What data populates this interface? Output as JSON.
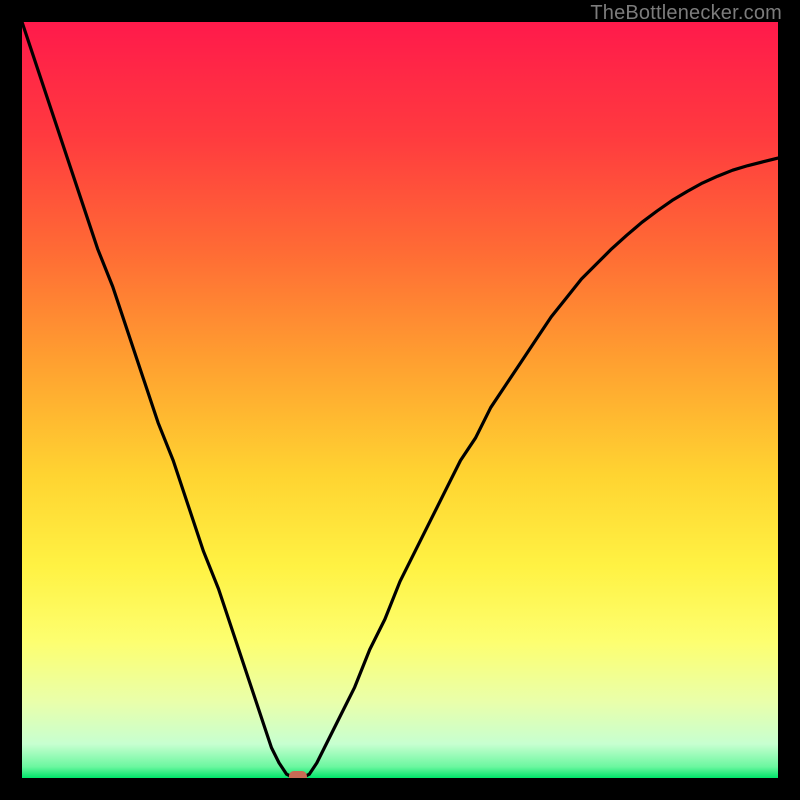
{
  "attribution": "TheBottlenecker.com",
  "chart_data": {
    "type": "line",
    "title": "",
    "xlabel": "",
    "ylabel": "",
    "xlim": [
      0,
      100
    ],
    "ylim": [
      0,
      100
    ],
    "curve": {
      "x": [
        0,
        2,
        4,
        6,
        8,
        10,
        12,
        14,
        16,
        18,
        20,
        22,
        24,
        26,
        28,
        30,
        32,
        33,
        34,
        35,
        36,
        37,
        38,
        39,
        40,
        42,
        44,
        46,
        48,
        50,
        52,
        54,
        56,
        58,
        60,
        62,
        64,
        66,
        68,
        70,
        72,
        74,
        76,
        78,
        80,
        82,
        84,
        86,
        88,
        90,
        92,
        94,
        96,
        98,
        100
      ],
      "y": [
        100,
        94,
        88,
        82,
        76,
        70,
        65,
        59,
        53,
        47,
        42,
        36,
        30,
        25,
        19,
        13,
        7,
        4,
        2,
        0.5,
        0,
        0,
        0.5,
        2,
        4,
        8,
        12,
        17,
        21,
        26,
        30,
        34,
        38,
        42,
        45,
        49,
        52,
        55,
        58,
        61,
        63.5,
        66,
        68,
        70,
        71.8,
        73.5,
        75,
        76.4,
        77.6,
        78.7,
        79.6,
        80.4,
        81,
        81.5,
        82
      ]
    },
    "marker": {
      "x": 36.5,
      "y": 0
    },
    "gradient_stops": [
      {
        "offset": 0.0,
        "color": "#ff1a4b"
      },
      {
        "offset": 0.15,
        "color": "#ff3a3f"
      },
      {
        "offset": 0.3,
        "color": "#ff6a35"
      },
      {
        "offset": 0.45,
        "color": "#ffa030"
      },
      {
        "offset": 0.6,
        "color": "#ffd431"
      },
      {
        "offset": 0.72,
        "color": "#fff243"
      },
      {
        "offset": 0.82,
        "color": "#fdff70"
      },
      {
        "offset": 0.9,
        "color": "#e9ffab"
      },
      {
        "offset": 0.955,
        "color": "#c7ffd0"
      },
      {
        "offset": 0.985,
        "color": "#6cf7a0"
      },
      {
        "offset": 1.0,
        "color": "#00e56a"
      }
    ]
  }
}
